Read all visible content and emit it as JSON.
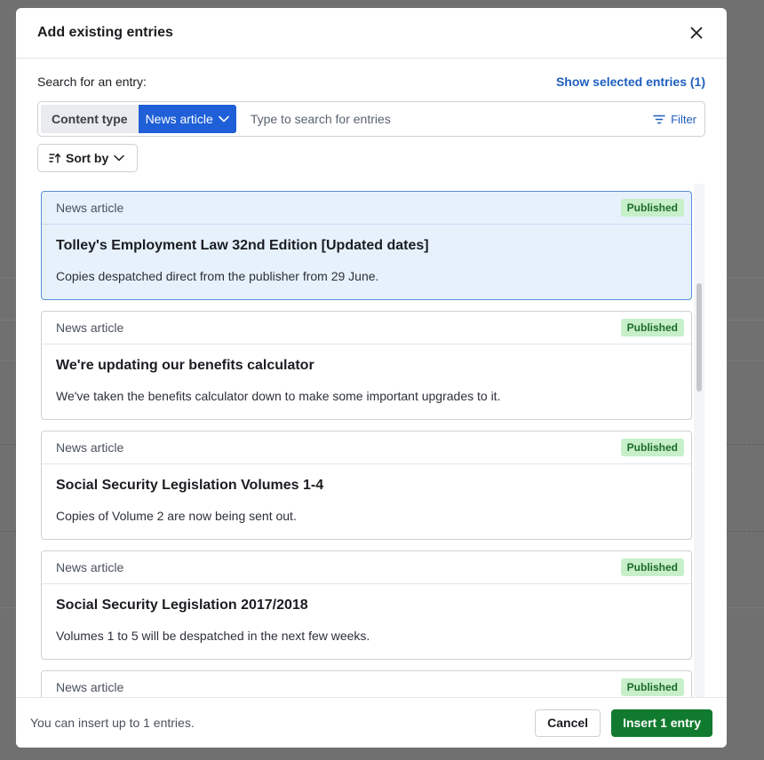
{
  "modal": {
    "title": "Add existing entries"
  },
  "search": {
    "label": "Search for an entry:",
    "show_selected": "Show selected entries (1)",
    "content_type_label": "Content type",
    "content_type_value": "News article",
    "placeholder": "Type to search for entries",
    "value": "",
    "filter_label": "Filter"
  },
  "sort": {
    "label": "Sort by"
  },
  "entries": [
    {
      "type": "News article",
      "status": "Published",
      "title": "Tolley's Employment Law 32nd Edition [Updated dates]",
      "description": "Copies despatched direct from the publisher from 29 June.",
      "selected": true
    },
    {
      "type": "News article",
      "status": "Published",
      "title": "We're updating our benefits calculator",
      "description": "We've taken the benefits calculator down to make some important upgrades to it.",
      "selected": false
    },
    {
      "type": "News article",
      "status": "Published",
      "title": "Social Security Legislation Volumes 1-4",
      "description": "Copies of Volume 2 are now being sent out.",
      "selected": false
    },
    {
      "type": "News article",
      "status": "Published",
      "title": "Social Security Legislation 2017/2018",
      "description": "Volumes 1 to 5 will be despatched in the next few weeks.",
      "selected": false
    },
    {
      "type": "News article",
      "status": "Published",
      "title": "",
      "description": "",
      "selected": false
    }
  ],
  "footer": {
    "note": "You can insert up to 1 entries.",
    "cancel_label": "Cancel",
    "insert_label": "Insert 1 entry"
  },
  "colors": {
    "accent_blue": "#1f5fd8",
    "link_blue": "#1f5fbf",
    "insert_green": "#107a2e",
    "published_badge_bg": "#c7efc9",
    "selected_card_bg": "#e6f1fc"
  },
  "icons": [
    "close-icon",
    "chevron-down-icon",
    "filter-icon",
    "sort-icon"
  ]
}
